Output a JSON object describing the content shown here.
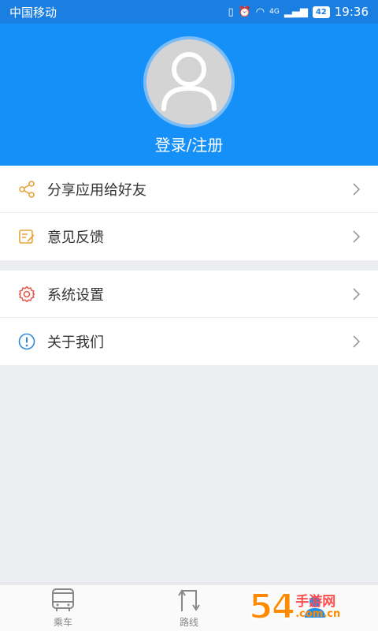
{
  "status_bar": {
    "carrier": "中国移动",
    "network": "4G",
    "battery": "42",
    "time": "19:36"
  },
  "profile": {
    "login_label": "登录/注册"
  },
  "menu_group_1": [
    {
      "label": "分享应用给好友",
      "icon": "share-icon"
    },
    {
      "label": "意见反馈",
      "icon": "feedback-icon"
    }
  ],
  "menu_group_2": [
    {
      "label": "系统设置",
      "icon": "gear-icon"
    },
    {
      "label": "关于我们",
      "icon": "info-icon"
    }
  ],
  "tabs": [
    {
      "label": "乘车",
      "icon": "bus-icon"
    },
    {
      "label": "路线",
      "icon": "route-icon"
    },
    {
      "label": "",
      "icon": "user-icon"
    }
  ],
  "watermark": {
    "number": "54",
    "text": "手游网",
    "url": ".com.cn"
  },
  "colors": {
    "header": "#1590f8",
    "status_bar": "#1b7fe2",
    "share": "#e8a33a",
    "feedback": "#e8a33a",
    "settings": "#e25a4a",
    "about": "#2c88d8"
  }
}
